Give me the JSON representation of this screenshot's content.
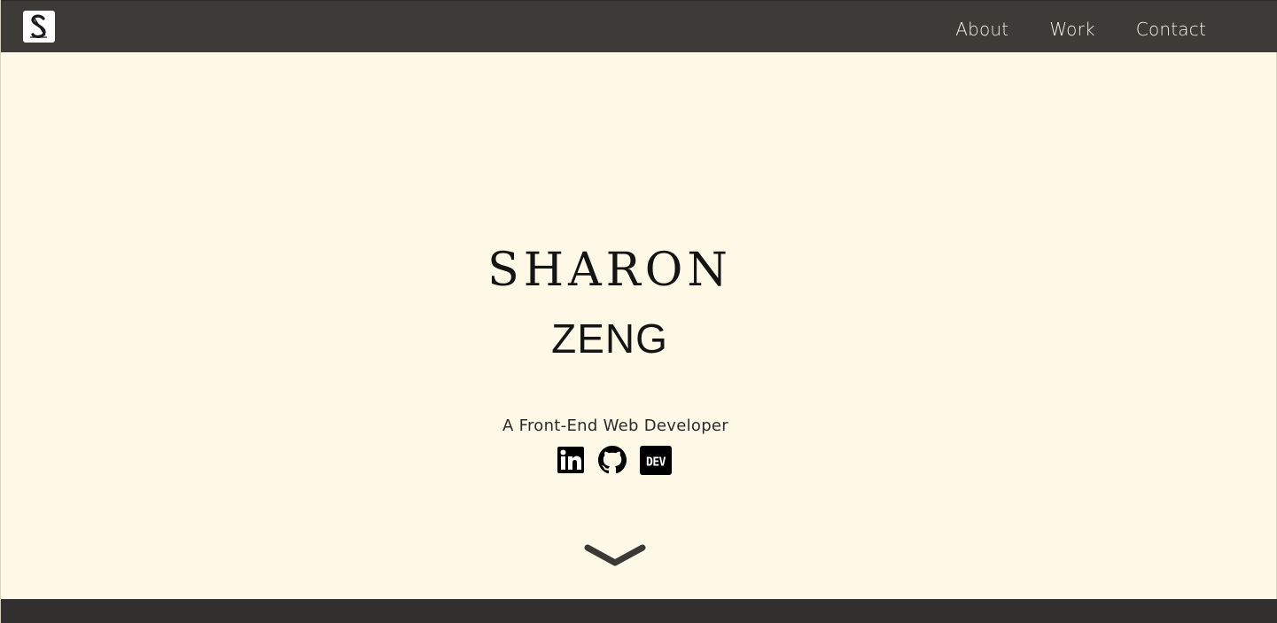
{
  "header": {
    "logo_icon": "s-monogram-logo-icon",
    "nav": [
      {
        "label": "About"
      },
      {
        "label": "Work"
      },
      {
        "label": "Contact"
      }
    ]
  },
  "hero": {
    "first_name": "SHARON",
    "last_name": "ZENG",
    "tagline": "A Front-End Web Developer",
    "socials": [
      {
        "icon": "linkedin-icon"
      },
      {
        "icon": "github-icon"
      },
      {
        "icon": "dev-icon",
        "text": "DEV"
      }
    ],
    "scroll_icon": "chevron-down-icon"
  },
  "colors": {
    "navbar": "#3c3b37",
    "background": "#fef8e6",
    "footer": "#31302e",
    "text": "#141414"
  }
}
